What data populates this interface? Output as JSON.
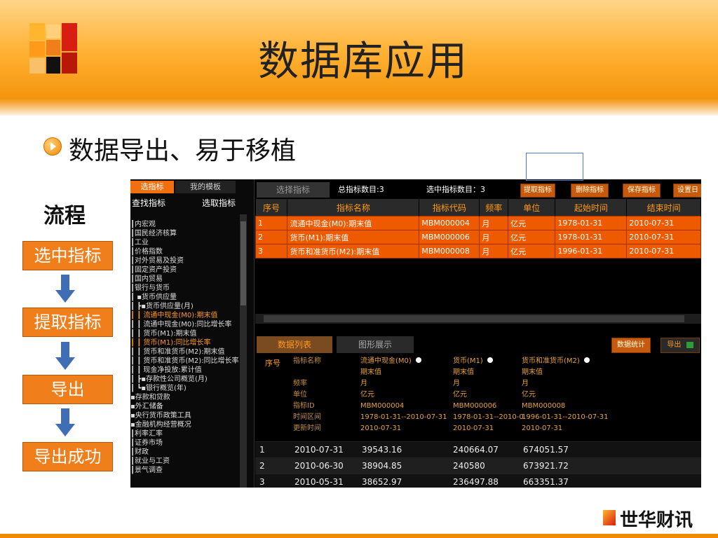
{
  "slide": {
    "title": "数据库应用",
    "bullet": "数据导出、易于移植",
    "flow_title": "流程",
    "flow_steps": [
      "选中指标",
      "提取指标",
      "导出",
      "导出成功"
    ],
    "brand": "世华财讯",
    "colors": {
      "accent": "#f07e1b",
      "arrow": "#3f6eb7"
    }
  },
  "app": {
    "left": {
      "tabs": [
        "选指标",
        "我的模板"
      ],
      "sub": [
        "查找指标",
        "选取指标"
      ],
      "tree": [
        {
          "t": "┃内宏观",
          "hl": false
        },
        {
          "t": "┃国民经济核算",
          "hl": false
        },
        {
          "t": "┃工业",
          "hl": false
        },
        {
          "t": "┃价格指数",
          "hl": false
        },
        {
          "t": "┃对外贸易及投资",
          "hl": false
        },
        {
          "t": "┃固定资产投资",
          "hl": false
        },
        {
          "t": "┃国内贸易",
          "hl": false
        },
        {
          "t": "┃银行与货币",
          "hl": false
        },
        {
          "t": "┃ ▪货币供应量",
          "hl": false
        },
        {
          "t": "┃ ┣▪货币供应量(月)",
          "hl": false
        },
        {
          "t": "┃ ┃  流通中现金(M0):期末值",
          "hl": true
        },
        {
          "t": "┃ ┃  流通中现金(M0):同比增长率",
          "hl": false
        },
        {
          "t": "┃ ┃  货币(M1):期末值",
          "hl": false
        },
        {
          "t": "┃ ┃  货币(M1):同比增长率",
          "hl": true
        },
        {
          "t": "┃ ┃  货币和准货币(M2):期末值",
          "hl": false
        },
        {
          "t": "┃ ┃  货币和准货币(M2):同比增长率",
          "hl": false
        },
        {
          "t": "┃ ┃  现金净投放:累计值",
          "hl": false
        },
        {
          "t": "┃ ┣▪存款性公司概览(月)",
          "hl": false
        },
        {
          "t": "┃ ┗▪银行概览(年)",
          "hl": false
        },
        {
          "t": "▪存款和贷款",
          "hl": false
        },
        {
          "t": "▪外汇储备",
          "hl": false
        },
        {
          "t": "▪央行货币政策工具",
          "hl": false
        },
        {
          "t": "▪金融机构经营概况",
          "hl": false
        },
        {
          "t": "┃利率汇率",
          "hl": false
        },
        {
          "t": "┃证券市场",
          "hl": false
        },
        {
          "t": "┃财政",
          "hl": false
        },
        {
          "t": "┃就业与工资",
          "hl": false
        },
        {
          "t": "┃景气调查",
          "hl": false
        }
      ]
    },
    "toolbar": {
      "tab": "选择指标",
      "total": "总指标数目:3",
      "selected": "选中指标数目：3",
      "buttons": [
        "提取指标",
        "删除指标",
        "保存指标",
        "设置日"
      ]
    },
    "table1": {
      "headers": [
        "序号",
        "指标名称",
        "指标代码",
        "频率",
        "单位",
        "起始时间",
        "结束时间"
      ],
      "rows": [
        [
          "1",
          "流通中现金(M0):期末值",
          "MBM000004",
          "月",
          "亿元",
          "1978-01-31",
          "2010-07-31"
        ],
        [
          "2",
          "货币(M1):期末值",
          "MBM000006",
          "月",
          "亿元",
          "1978-01-31",
          "2010-07-31"
        ],
        [
          "3",
          "货币和准货币(M2):期末值",
          "MBM000008",
          "月",
          "亿元",
          "1996-01-31",
          "2010-07-31"
        ]
      ]
    },
    "tabs2": [
      "数据列表",
      "图形展示"
    ],
    "stats_btn": "数据统计",
    "export_btn": "导出",
    "meta": {
      "seq_label": "序号",
      "keys": [
        "指标名称",
        "",
        "频率",
        "单位",
        "指标ID",
        "时间区间",
        "更新时间"
      ],
      "cols": [
        [
          "流通中现金(M0)",
          "期末值",
          "月",
          "亿元",
          "MBM000004",
          "1978-01-31--2010-07-31",
          "2010-07-31"
        ],
        [
          "货币(M1)",
          "期末值",
          "月",
          "亿元",
          "MBM000006",
          "1978-01-31--2010-0",
          "2010-07-31"
        ],
        [
          "货币和准货币(M2)",
          "期末值",
          "月",
          "亿元",
          "MBM000008",
          "1996-01-31--2010-07-31",
          "2010-07-31"
        ]
      ]
    },
    "data_rows": [
      [
        "1",
        "2010-07-31",
        "39543.16",
        "240664.07",
        "674051.57"
      ],
      [
        "2",
        "2010-06-30",
        "38904.85",
        "240580",
        "673921.72"
      ],
      [
        "3",
        "2010-05-31",
        "38652.97",
        "236497.88",
        "663351.37"
      ]
    ]
  }
}
